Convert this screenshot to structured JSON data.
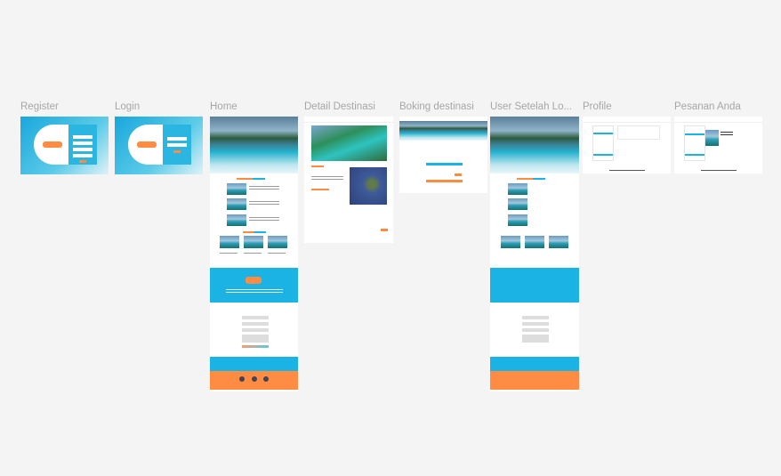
{
  "frames": [
    {
      "label": "Register"
    },
    {
      "label": "Login"
    },
    {
      "label": "Home"
    },
    {
      "label": "Detail Destinasi"
    },
    {
      "label": "Boking destinasi"
    },
    {
      "label": "User Setelah Lo..."
    },
    {
      "label": "Profile"
    },
    {
      "label": "Pesanan Anda"
    }
  ],
  "colors": {
    "canvas": "#f4f4f4",
    "accent_blue": "#1ab3e3",
    "accent_orange": "#ff8c42"
  }
}
